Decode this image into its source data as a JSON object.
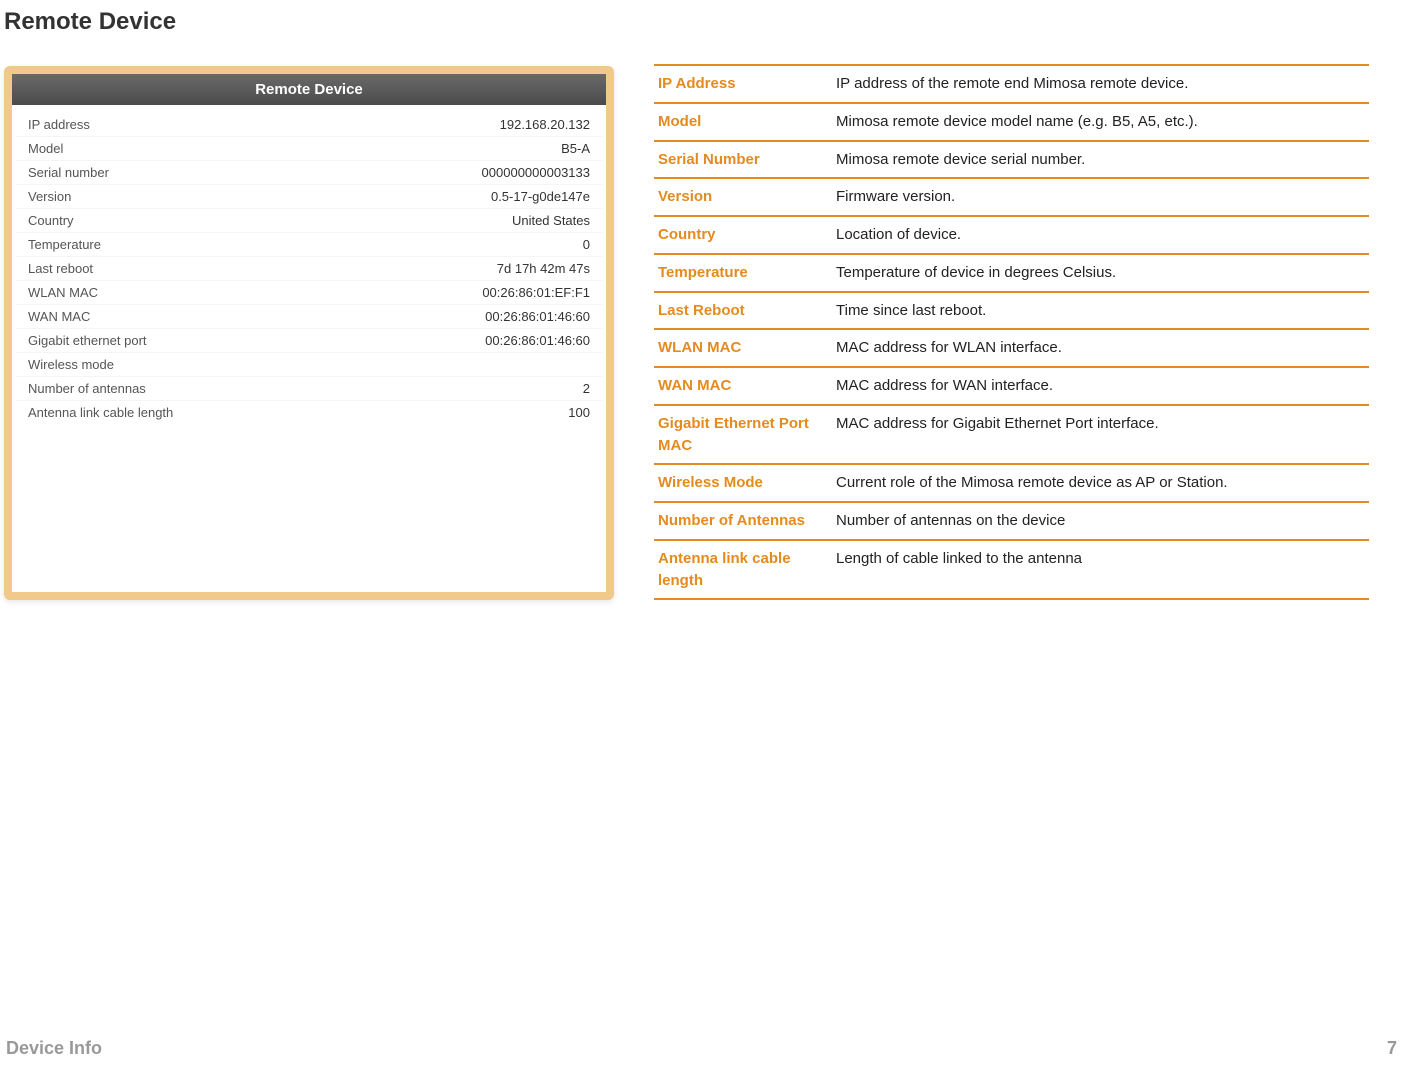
{
  "title": "Remote Device",
  "panel": {
    "header": "Remote Device",
    "rows": [
      {
        "label": "IP address",
        "value": "192.168.20.132"
      },
      {
        "label": "Model",
        "value": "B5-A"
      },
      {
        "label": "Serial number",
        "value": "000000000003133"
      },
      {
        "label": "Version",
        "value": "0.5-17-g0de147e"
      },
      {
        "label": "Country",
        "value": "United States"
      },
      {
        "label": "Temperature",
        "value": "0"
      },
      {
        "label": "Last reboot",
        "value": "7d 17h 42m 47s"
      },
      {
        "label": "WLAN MAC",
        "value": "00:26:86:01:EF:F1"
      },
      {
        "label": "WAN MAC",
        "value": "00:26:86:01:46:60"
      },
      {
        "label": "Gigabit ethernet port",
        "value": "00:26:86:01:46:60"
      },
      {
        "label": "Wireless mode",
        "value": ""
      },
      {
        "label": "Number of antennas",
        "value": "2"
      },
      {
        "label": "Antenna link cable length",
        "value": "100"
      }
    ]
  },
  "desc": [
    {
      "label": "IP Address",
      "value": "IP address of the remote end Mimosa remote device."
    },
    {
      "label": "Model",
      "value": "Mimosa remote device model name (e.g. B5, A5, etc.)."
    },
    {
      "label": "Serial Number",
      "value": "Mimosa remote device serial number."
    },
    {
      "label": "Version",
      "value": "Firmware version."
    },
    {
      "label": "Country",
      "value": "Location of device."
    },
    {
      "label": "Temperature",
      "value": "Temperature of device in degrees Celsius."
    },
    {
      "label": "Last Reboot",
      "value": "Time since last reboot."
    },
    {
      "label": "WLAN MAC",
      "value": "MAC address for WLAN interface."
    },
    {
      "label": "WAN MAC",
      "value": "MAC address for WAN interface."
    },
    {
      "label": "Gigabit Ethernet Port MAC",
      "value": "MAC address for Gigabit Ethernet Port interface."
    },
    {
      "label": "Wireless Mode",
      "value": "Current role of the Mimosa remote device as AP or Station."
    },
    {
      "label": "Number of Antennas",
      "value": "Number of antennas on the device"
    },
    {
      "label": "Antenna link cable length",
      "value": "Length of cable linked to the antenna"
    }
  ],
  "footer": {
    "left": "Device Info",
    "right": "7"
  }
}
